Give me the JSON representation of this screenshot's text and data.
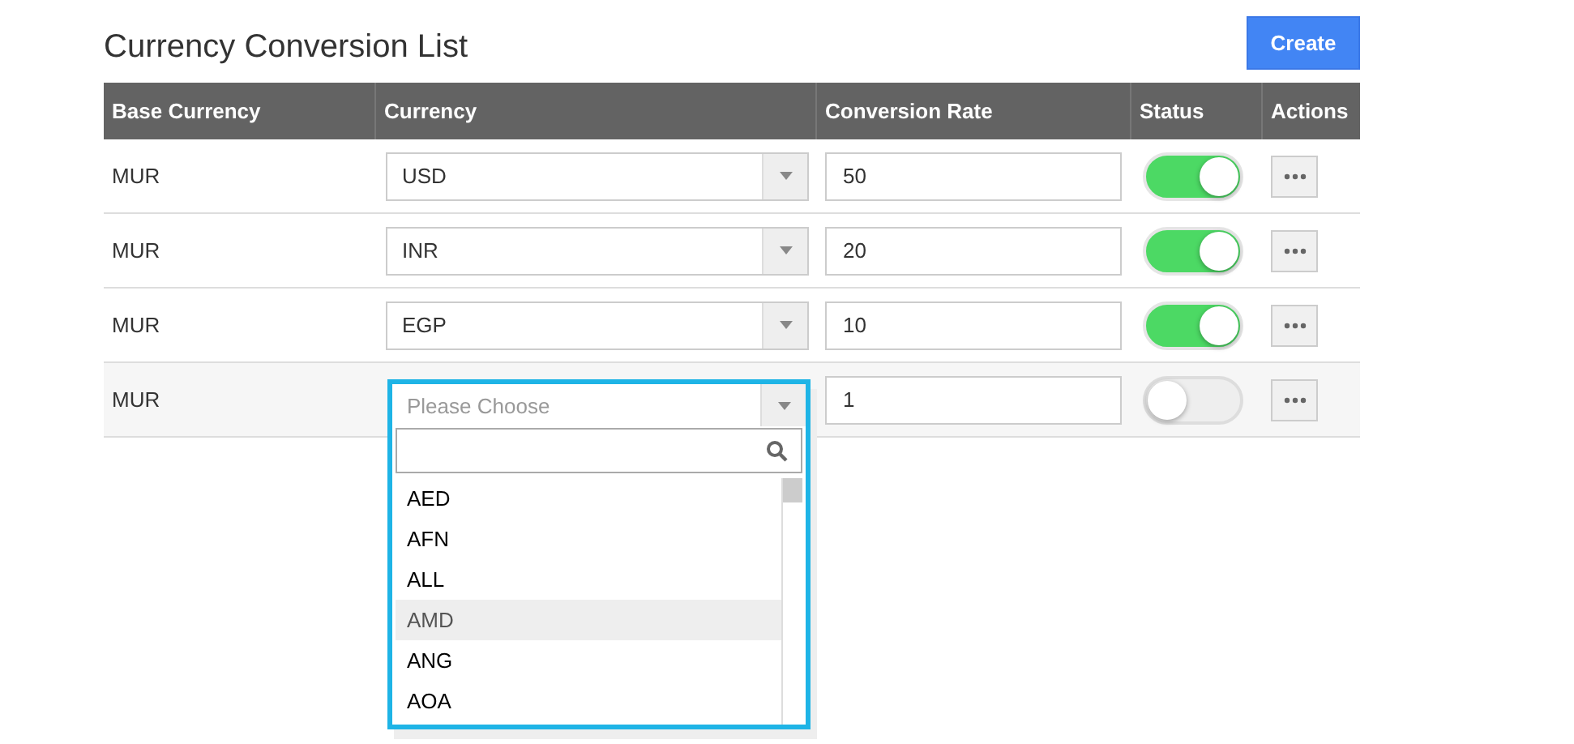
{
  "title": "Currency Conversion List",
  "create_button": "Create",
  "table": {
    "columns": [
      "Base Currency",
      "Currency",
      "Conversion Rate",
      "Status",
      "Actions"
    ],
    "rows": [
      {
        "base": "MUR",
        "currency": "USD",
        "rate": "50",
        "on": true,
        "open": false
      },
      {
        "base": "MUR",
        "currency": "INR",
        "rate": "20",
        "on": true,
        "open": false
      },
      {
        "base": "MUR",
        "currency": "EGP",
        "rate": "10",
        "on": true,
        "open": false
      },
      {
        "base": "MUR",
        "placeholder": "Please Choose",
        "rate": "1",
        "on": false,
        "open": true,
        "options": [
          {
            "label": "AED",
            "selected": false
          },
          {
            "label": "AFN",
            "selected": false
          },
          {
            "label": "ALL",
            "selected": false
          },
          {
            "label": "AMD",
            "selected": true
          },
          {
            "label": "ANG",
            "selected": false
          },
          {
            "label": "AOA",
            "selected": false
          }
        ]
      }
    ]
  }
}
